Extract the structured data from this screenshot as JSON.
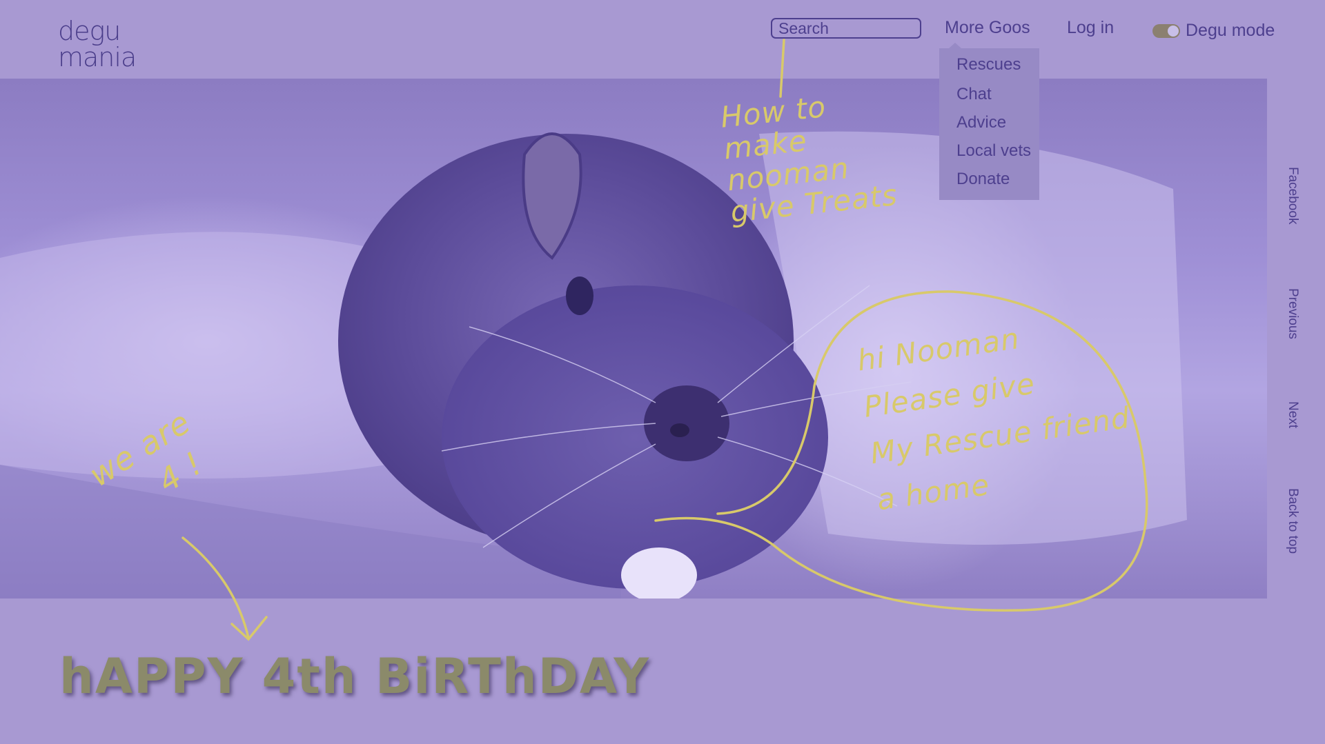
{
  "logo": {
    "line1": "degu",
    "line2": "mania"
  },
  "header": {
    "search_placeholder": "Search",
    "more_goos": "More Goos",
    "login": "Log in",
    "degu_mode": "Degu mode"
  },
  "dropdown": {
    "items": [
      "Rescues",
      "Chat",
      "Advice",
      "Local vets",
      "Donate"
    ]
  },
  "side_nav": {
    "facebook": "Facebook",
    "previous": "Previous",
    "next": "Next",
    "back_to_top": "Back to top"
  },
  "annotations": {
    "treats": [
      "How to",
      "make",
      "nooman",
      "give Treats"
    ],
    "speech": [
      "hi Nooman",
      "Please give",
      "My Rescue friend",
      "a home"
    ],
    "we_are": [
      "we are",
      "4 !"
    ]
  },
  "banner": {
    "text": "hAPPY 4th BiRThDAY"
  },
  "colors": {
    "background": "#a899d2",
    "text": "#4d3f8e",
    "handwriting": "#d8c96a",
    "banner": "#8b8a6a"
  }
}
